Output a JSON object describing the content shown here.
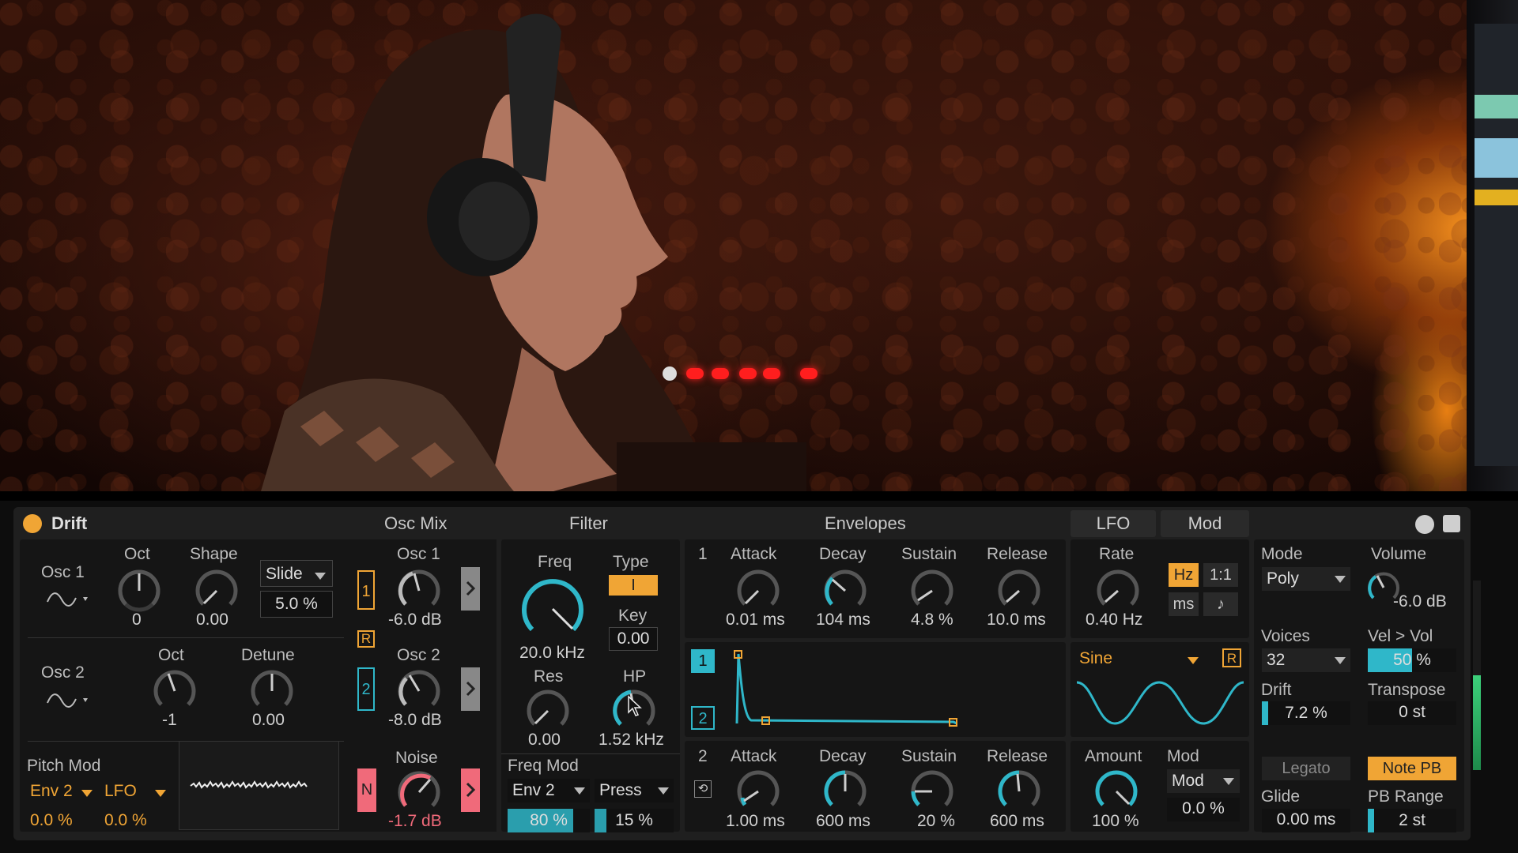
{
  "device": {
    "name": "Drift",
    "sections": {
      "osc_mix": "Osc Mix",
      "filter": "Filter",
      "envelopes": "Envelopes"
    },
    "tabs": [
      "LFO",
      "Mod"
    ]
  },
  "osc1": {
    "label": "Osc 1",
    "oct_label": "Oct",
    "oct_value": "0",
    "shape_label": "Shape",
    "shape_value": "0.00",
    "slide_mode": "Slide",
    "slide_value": "5.0 %"
  },
  "osc2": {
    "label": "Osc 2",
    "oct_label": "Oct",
    "oct_value": "-1",
    "detune_label": "Detune",
    "detune_value": "0.00"
  },
  "pitch_mod": {
    "label": "Pitch Mod",
    "src1": "Env 2",
    "src2": "LFO",
    "amt1": "0.0 %",
    "amt2": "0.0 %"
  },
  "mix": {
    "osc1_label": "Osc 1",
    "osc1_value": "-6.0 dB",
    "osc1_btn": "1",
    "r_btn": "R",
    "osc2_label": "Osc 2",
    "osc2_value": "-8.0 dB",
    "osc2_btn": "2",
    "noise_label": "Noise",
    "noise_value": "-1.7 dB",
    "noise_btn": "N"
  },
  "filter": {
    "freq_label": "Freq",
    "freq_value": "20.0 kHz",
    "type_label": "Type",
    "type_value": "I",
    "key_label": "Key",
    "key_value": "0.00",
    "res_label": "Res",
    "res_value": "0.00",
    "hp_label": "HP",
    "hp_value": "1.52 kHz",
    "freq_mod_label": "Freq Mod",
    "mod_src1": "Env 2",
    "mod_src2": "Press",
    "mod_amt1": "80 %",
    "mod_amt2": "15 %",
    "mod_amt1_level": 0.8,
    "mod_amt2_level": 0.15
  },
  "env1": {
    "number": "1",
    "attack_label": "Attack",
    "attack_value": "0.01 ms",
    "decay_label": "Decay",
    "decay_value": "104 ms",
    "sustain_label": "Sustain",
    "sustain_value": "4.8 %",
    "release_label": "Release",
    "release_value": "10.0 ms",
    "view_btn1": "1",
    "view_btn2": "2"
  },
  "env2": {
    "number": "2",
    "attack_label": "Attack",
    "attack_value": "1.00 ms",
    "decay_label": "Decay",
    "decay_value": "600 ms",
    "sustain_label": "Sustain",
    "sustain_value": "20 %",
    "release_label": "Release",
    "release_value": "600 ms"
  },
  "lfo": {
    "rate_label": "Rate",
    "rate_value": "0.40 Hz",
    "hz_btn": "Hz",
    "ratio_btn": "1:1",
    "ms_btn": "ms",
    "note_btn": "♪",
    "wave": "Sine",
    "retrig": "R",
    "amount_label": "Amount",
    "amount_value": "100 %",
    "mod_label": "Mod",
    "mod_src": "Mod",
    "mod_value": "0.0 %"
  },
  "global": {
    "mode_label": "Mode",
    "mode_value": "Poly",
    "voices_label": "Voices",
    "voices_value": "32",
    "drift_label": "Drift",
    "drift_value": "7.2 %",
    "drift_level": 0.072,
    "legato": "Legato",
    "glide_label": "Glide",
    "glide_value": "0.00 ms",
    "volume_label": "Volume",
    "volume_value": "-6.0 dB",
    "velvol_label": "Vel > Vol",
    "velvol_value": "50 %",
    "velvol_level": 0.5,
    "transpose_label": "Transpose",
    "transpose_value": "0 st",
    "note_pb": "Note PB",
    "pb_range_label": "PB Range",
    "pb_range_value": "2 st"
  },
  "colors": {
    "accent": "#f0a535",
    "teal": "#2fb7c9",
    "pink": "#f06a7a"
  }
}
